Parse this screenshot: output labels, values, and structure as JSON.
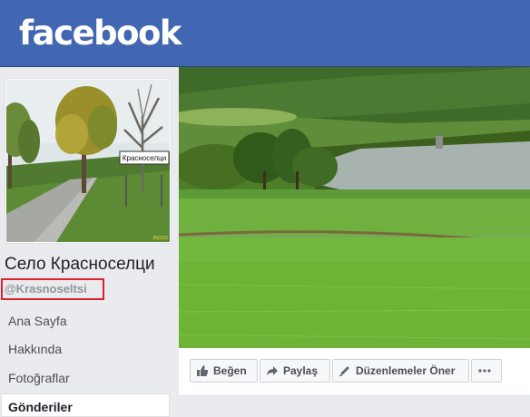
{
  "header": {
    "logo_text": "facebook",
    "bg_color": "#4267b2"
  },
  "page": {
    "name": "Село Красноселци",
    "handle": "@Krasnoseltsi",
    "sign_text": "Красноселци",
    "photo_stamp": "26/10/2"
  },
  "nav": {
    "items": [
      {
        "label": "Ana Sayfa"
      },
      {
        "label": "Hakkında"
      },
      {
        "label": "Fotoğraflar"
      },
      {
        "label": "Gönderiler"
      }
    ]
  },
  "actions": {
    "like": "Beğen",
    "share": "Paylaş",
    "suggest_edits": "Düzenlemeler Öner",
    "more_icon": "ellipsis-icon"
  },
  "colors": {
    "highlight_border": "#e0202b",
    "text_muted": "#90949c"
  }
}
